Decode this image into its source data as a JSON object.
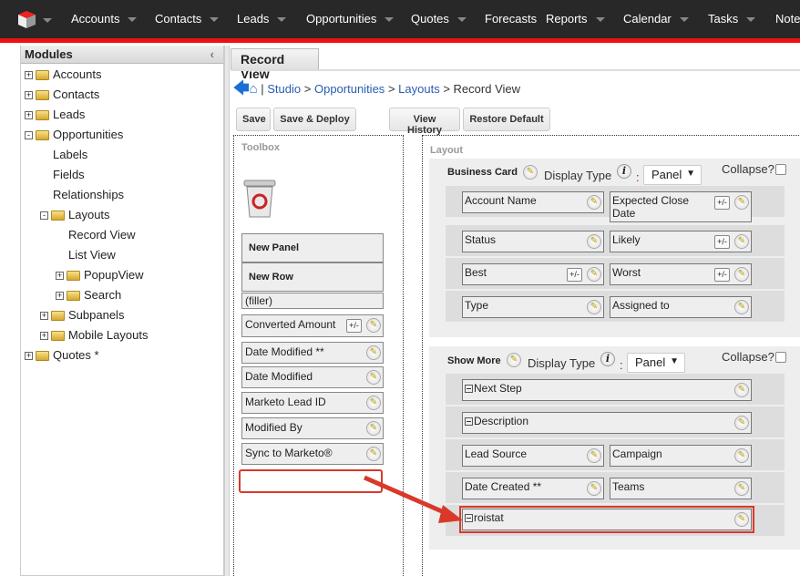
{
  "nav": {
    "items": [
      "Accounts",
      "Contacts",
      "Leads",
      "Opportunities",
      "Quotes",
      "Forecasts",
      "Reports",
      "Calendar",
      "Tasks",
      "Notes"
    ]
  },
  "modules": {
    "title": "Modules",
    "collapse_icon": "chevron-left-icon",
    "tree": [
      {
        "label": "Accounts",
        "expand": "+"
      },
      {
        "label": "Contacts",
        "expand": "+"
      },
      {
        "label": "Leads",
        "expand": "+"
      },
      {
        "label": "Opportunities",
        "expand": "-"
      },
      {
        "label": "Labels"
      },
      {
        "label": "Fields"
      },
      {
        "label": "Relationships"
      },
      {
        "label": "Layouts",
        "expand": "-"
      },
      {
        "label": "Record View"
      },
      {
        "label": "List View"
      },
      {
        "label": "PopupView",
        "expand": "+"
      },
      {
        "label": "Search",
        "expand": "+"
      },
      {
        "label": "Subpanels",
        "expand": "+"
      },
      {
        "label": "Mobile Layouts",
        "expand": "+"
      },
      {
        "label": "Quotes *",
        "expand": "+"
      }
    ]
  },
  "tab": "Record View",
  "breadcrumb": {
    "sep": "|",
    "studio": "Studio",
    "module": "Opportunities",
    "layouts": "Layouts",
    "current": "Record View",
    "gt": ">"
  },
  "buttons": {
    "save": "Save",
    "save_deploy": "Save & Deploy",
    "view_history": "View History",
    "restore_default": "Restore Default"
  },
  "toolbox": {
    "title": "Toolbox",
    "new_panel": "New Panel",
    "new_row": "New Row",
    "filler": "(filler)",
    "fields": [
      {
        "label": "Converted Amount",
        "pm": true
      },
      {
        "label": "Date Modified **"
      },
      {
        "label": "Date Modified"
      },
      {
        "label": "Marketo Lead ID"
      },
      {
        "label": "Modified By"
      },
      {
        "label": "Sync to Marketo®"
      }
    ]
  },
  "layout": {
    "title": "Layout",
    "display_type": "Display Type",
    "colon": ":",
    "collapse": "Collapse?",
    "pm": "+/-",
    "panels": [
      {
        "name": "Business Card",
        "type": "Panel",
        "rows": [
          [
            {
              "label": "Account Name"
            },
            {
              "label": "Expected Close Date",
              "pm": true
            }
          ],
          [
            {
              "label": "Status"
            },
            {
              "label": "Likely",
              "pm": true
            }
          ],
          [
            {
              "label": "Best",
              "pm": true
            },
            {
              "label": "Worst",
              "pm": true
            }
          ],
          [
            {
              "label": "Type"
            },
            {
              "label": "Assigned to"
            }
          ]
        ]
      },
      {
        "name": "Show More",
        "type": "Panel",
        "rows": [
          [
            {
              "label": "Next Step",
              "full": true
            }
          ],
          [
            {
              "label": "Description",
              "full": true
            }
          ],
          [
            {
              "label": "Lead Source"
            },
            {
              "label": "Campaign"
            }
          ],
          [
            {
              "label": "Date Created **"
            },
            {
              "label": "Teams"
            }
          ],
          [
            {
              "label": "roistat",
              "full": true,
              "highlight": true
            }
          ]
        ]
      }
    ]
  },
  "colors": {
    "accent": "#ee1111",
    "nav_bg": "#282828",
    "link": "#2a5db0",
    "highlight": "#d9392b"
  }
}
